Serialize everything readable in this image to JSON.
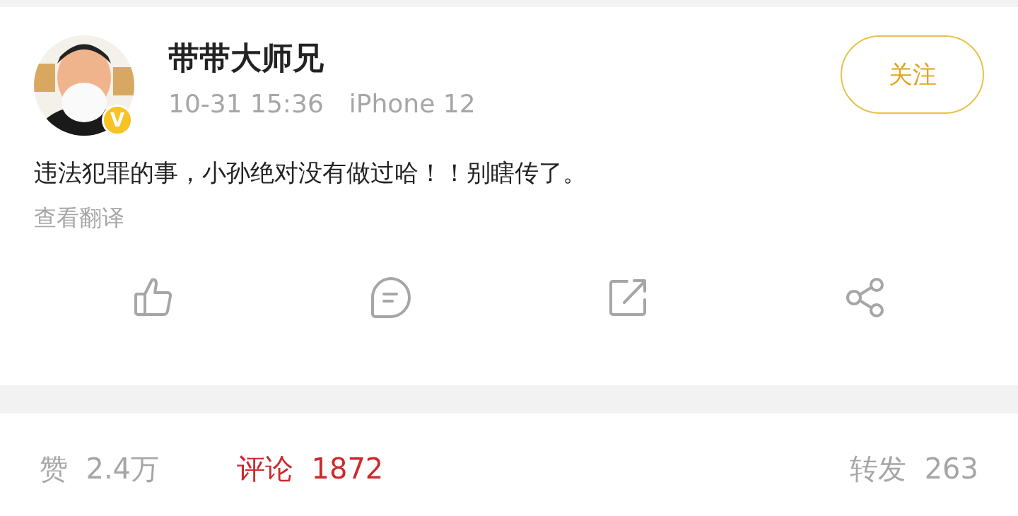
{
  "post": {
    "author": "带带大师兄",
    "verified_badge": "V",
    "time": "10-31 15:36",
    "device": "iPhone 12",
    "follow_button": "关注",
    "text": "违法犯罪的事，小孙绝对没有做过哈！！别瞎传了。",
    "translate_link": "查看翻译",
    "actions": [
      {
        "kind": "like"
      },
      {
        "kind": "comment"
      },
      {
        "kind": "repost"
      },
      {
        "kind": "share"
      }
    ]
  },
  "stats_tabs": [
    {
      "label": "赞",
      "count": "2.4万",
      "selected": false
    },
    {
      "label": "评论",
      "count": "1872",
      "selected": true
    },
    {
      "label": "转发",
      "count": "263",
      "selected": false
    }
  ]
}
